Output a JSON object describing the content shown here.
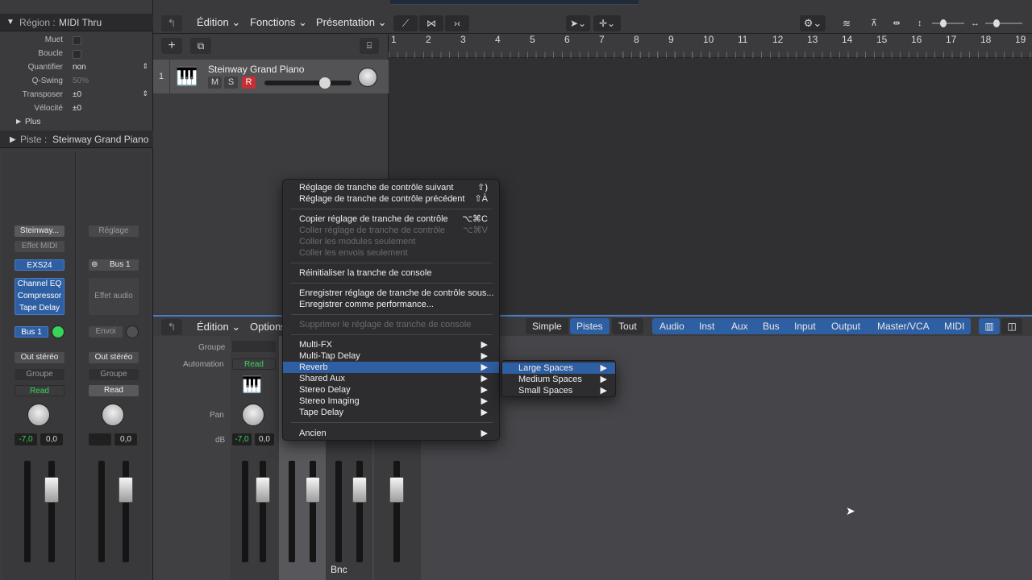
{
  "inspector": {
    "region_title": "Région :",
    "region_value": "MIDI Thru",
    "params": [
      {
        "label": "Muet",
        "type": "check"
      },
      {
        "label": "Boucle",
        "type": "check"
      },
      {
        "label": "Quantifier",
        "value": "non"
      },
      {
        "label": "Q-Swing",
        "value": "50%"
      },
      {
        "label": "Transposer",
        "value": "±0"
      },
      {
        "label": "Vélocité",
        "value": "±0"
      }
    ],
    "plus": "Plus",
    "track_title": "Piste :",
    "track_value": "Steinway Grand Piano",
    "strip1": {
      "name": "Steinway...",
      "midi_fx": "Effet MIDI",
      "instrument": "EXS24",
      "fx": [
        "Channel EQ",
        "Compressor",
        "Tape Delay"
      ],
      "send": "Bus 1",
      "output": "Out stéréo",
      "group": "Groupe",
      "automation": "Read",
      "vol": "-7,0",
      "pan": "0,0"
    },
    "strip2": {
      "setting": "Réglage",
      "input": "Bus 1",
      "audio_fx": "Effet audio",
      "send": "Envoi",
      "output": "Out stéréo",
      "group": "Groupe",
      "automation": "Read",
      "vol": "",
      "pan": "0,0"
    }
  },
  "toolbar": {
    "edit": "Édition",
    "functions": "Fonctions",
    "view": "Présentation"
  },
  "ruler": [
    "1",
    "2",
    "3",
    "4",
    "5",
    "6",
    "7",
    "8",
    "9",
    "10",
    "11",
    "12",
    "13",
    "14",
    "15",
    "16",
    "17",
    "18",
    "19"
  ],
  "track": {
    "number": "1",
    "name": "Steinway Grand Piano",
    "m": "M",
    "s": "S",
    "r": "R"
  },
  "mixer": {
    "edit": "Édition",
    "options": "Options",
    "group_lbl": "Groupe",
    "automation_lbl": "Automation",
    "automation_val": "Read",
    "pan_lbl": "Pan",
    "db_lbl": "dB",
    "vol": "-7,0",
    "pan": "0,0",
    "bnc": "Bnc",
    "view_tabs": [
      "Simple",
      "Pistes",
      "Tout"
    ],
    "type_tabs": [
      "Audio",
      "Inst",
      "Aux",
      "Bus",
      "Input",
      "Output",
      "Master/VCA",
      "MIDI"
    ]
  },
  "context_menu": {
    "items": [
      {
        "label": "Réglage de tranche de contrôle suivant",
        "shortcut": "⇧)"
      },
      {
        "label": "Réglage de tranche de contrôle précédent",
        "shortcut": "⇧À"
      },
      {
        "label": "Copier réglage de tranche de contrôle",
        "shortcut": "⌥⌘C"
      },
      {
        "label": "Coller réglage de tranche de contrôle",
        "shortcut": "⌥⌘V"
      },
      {
        "label": "Coller les modules seulement"
      },
      {
        "label": "Coller les envois seulement"
      },
      {
        "label": "Réinitialiser la tranche de console"
      },
      {
        "label": "Enregistrer réglage de tranche de contrôle sous..."
      },
      {
        "label": "Enregistrer comme performance..."
      },
      {
        "label": "Supprimer le réglage de tranche de console"
      },
      {
        "label": "Multi-FX"
      },
      {
        "label": "Multi-Tap Delay"
      },
      {
        "label": "Reverb"
      },
      {
        "label": "Shared Aux"
      },
      {
        "label": "Stereo Delay"
      },
      {
        "label": "Stereo Imaging"
      },
      {
        "label": "Tape Delay"
      },
      {
        "label": "Ancien"
      }
    ],
    "submenu": [
      "Large Spaces",
      "Medium Spaces",
      "Small Spaces"
    ]
  }
}
